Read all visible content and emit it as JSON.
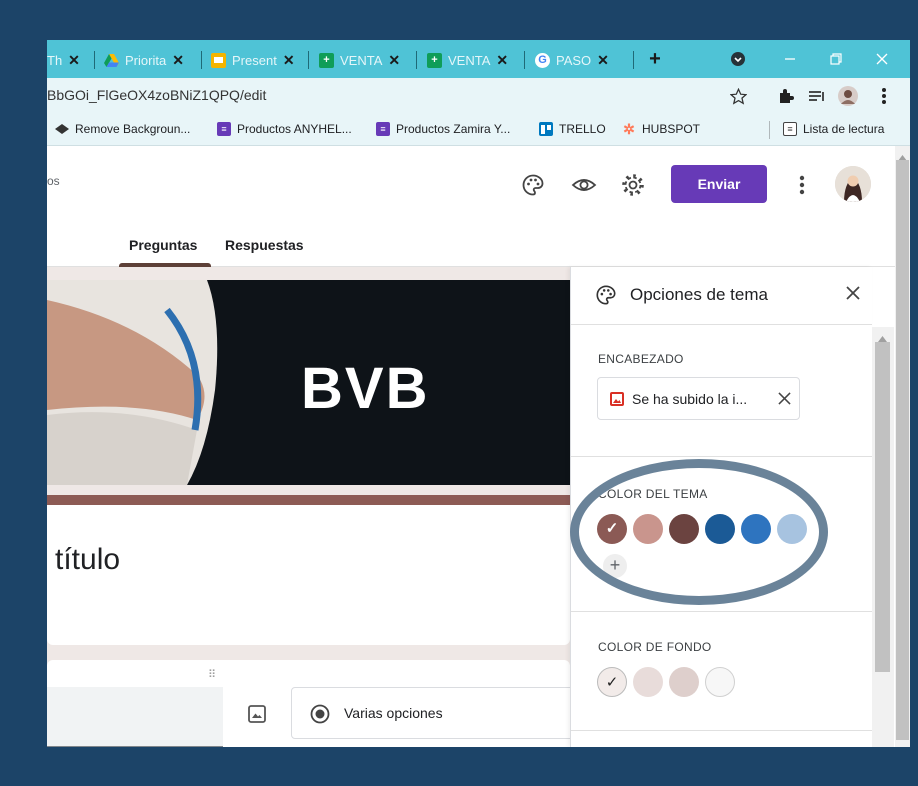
{
  "browser": {
    "tabs": [
      {
        "title": "Th",
        "icon": "generic-tab-icon"
      },
      {
        "title": "Priorita",
        "icon": "google-drive-icon"
      },
      {
        "title": "Present",
        "icon": "google-slides-icon"
      },
      {
        "title": "VENTA",
        "icon": "google-sheets-icon"
      },
      {
        "title": "VENTA",
        "icon": "google-sheets-icon"
      },
      {
        "title": "PASO",
        "icon": "google-icon"
      }
    ],
    "tab_close": "✕",
    "new_tab": "+",
    "url": "BbGOi_FlGeOX4zoBNiZ1QPQ/edit",
    "bookmarks": [
      {
        "label": "Remove Backgroun...",
        "icon": "remove-bg-icon"
      },
      {
        "label": "Productos ANYHEL...",
        "icon": "list-icon"
      },
      {
        "label": "Productos Zamira Y...",
        "icon": "list-icon"
      },
      {
        "label": "TRELLO",
        "icon": "trello-icon"
      },
      {
        "label": "HUBSPOT",
        "icon": "hubspot-icon"
      }
    ],
    "reading_list": "Lista de lectura"
  },
  "forms": {
    "header_fragment": "os",
    "send_label": "Enviar",
    "tabs": [
      "Preguntas",
      "Respuestas"
    ],
    "banner_logo_text": "BVB",
    "form_title_fragment": "título",
    "question_type": "Varias opciones",
    "drag_handle": "⠿"
  },
  "theme_panel": {
    "title": "Opciones de tema",
    "header_section_label": "ENCABEZADO",
    "upload_chip_text": "Se ha subido la i...",
    "theme_color_label": "COLOR DEL TEMA",
    "theme_colors": [
      "#8b5a55",
      "#c9958d",
      "#6b4340",
      "#1b5a96",
      "#2e74bf",
      "#a7c3e0"
    ],
    "selected_theme_color": 0,
    "add_color": "+",
    "background_label": "COLOR DE FONDO",
    "background_colors": [
      "#f2ebe9",
      "#e8dcda",
      "#decfcc",
      "#f7f7f7"
    ],
    "selected_background": 0,
    "check": "✓",
    "close": "✕"
  },
  "colors": {
    "accent_purple": "#673ab7",
    "tabstrip": "#4fc3d6",
    "annotation_ring": "#6a8399",
    "page_frame": "#1c4468"
  }
}
